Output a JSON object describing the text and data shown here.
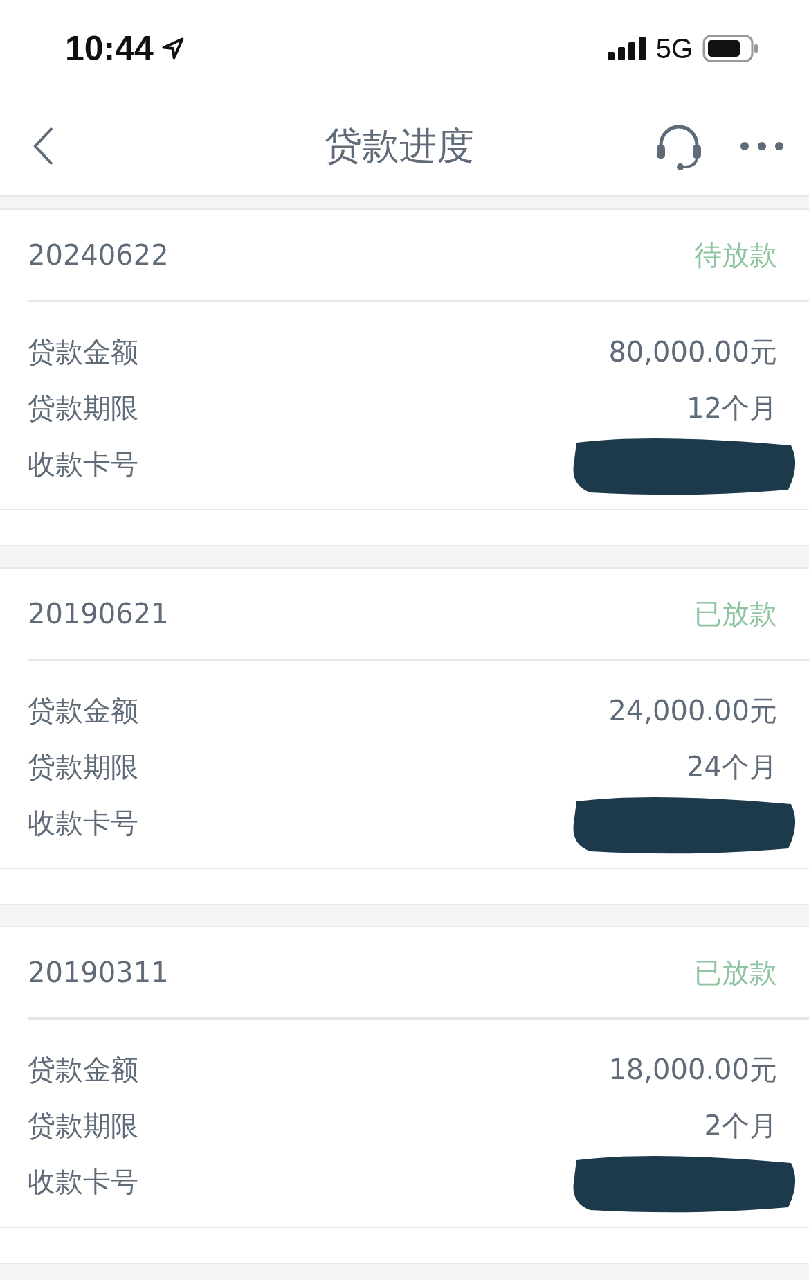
{
  "status_bar": {
    "time": "10:44",
    "network": "5G"
  },
  "nav": {
    "title": "贷款进度"
  },
  "loans": [
    {
      "date": "20240622",
      "status": "待放款",
      "rows": [
        {
          "kind": "text",
          "label": "贷款金额",
          "value": "80,000.00元"
        },
        {
          "kind": "text",
          "label": "贷款期限",
          "value": "12个月"
        },
        {
          "kind": "redacted",
          "label": "收款卡号"
        }
      ]
    },
    {
      "date": "20190621",
      "status": "已放款",
      "rows": [
        {
          "kind": "text",
          "label": "贷款金额",
          "value": "24,000.00元"
        },
        {
          "kind": "text",
          "label": "贷款期限",
          "value": "24个月"
        },
        {
          "kind": "redacted",
          "label": "收款卡号"
        }
      ]
    },
    {
      "date": "20190311",
      "status": "已放款",
      "rows": [
        {
          "kind": "text",
          "label": "贷款金额",
          "value": "18,000.00元"
        },
        {
          "kind": "text",
          "label": "贷款期限",
          "value": "2个月"
        },
        {
          "kind": "redacted",
          "label": "收款卡号"
        }
      ]
    }
  ]
}
